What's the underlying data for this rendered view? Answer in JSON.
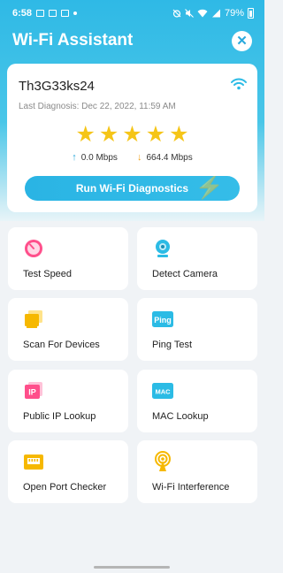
{
  "status": {
    "time": "6:58",
    "battery": "79%"
  },
  "header": {
    "title": "Wi-Fi Assistant",
    "close_icon": "close-icon"
  },
  "network": {
    "ssid": "Th3G33ks24",
    "last_diagnosis": "Last Diagnosis: Dec 22, 2022, 11:59 AM",
    "rating_stars": 5,
    "upload": "0.0 Mbps",
    "download": "664.4 Mbps",
    "diagnostics_button": "Run Wi-Fi Diagnostics"
  },
  "tools": [
    {
      "label": "Test Speed",
      "icon": "speedometer-icon",
      "color": "#ff4f8b"
    },
    {
      "label": "Detect Camera",
      "icon": "camera-icon",
      "color": "#2bbbe5"
    },
    {
      "label": "Scan For Devices",
      "icon": "devices-icon",
      "color": "#f6b800"
    },
    {
      "label": "Ping Test",
      "icon": "ping-icon",
      "color": "#2bbbe5"
    },
    {
      "label": "Public IP Lookup",
      "icon": "ip-icon",
      "color": "#ff4f8b"
    },
    {
      "label": "MAC Lookup",
      "icon": "mac-icon",
      "color": "#2bbbe5"
    },
    {
      "label": "Open Port Checker",
      "icon": "port-icon",
      "color": "#f6b800"
    },
    {
      "label": "Wi-Fi Interference",
      "icon": "interference-icon",
      "color": "#f6b800"
    }
  ],
  "icon_text": {
    "ping": "Ping",
    "ip": "IP",
    "mac": "MAC"
  }
}
